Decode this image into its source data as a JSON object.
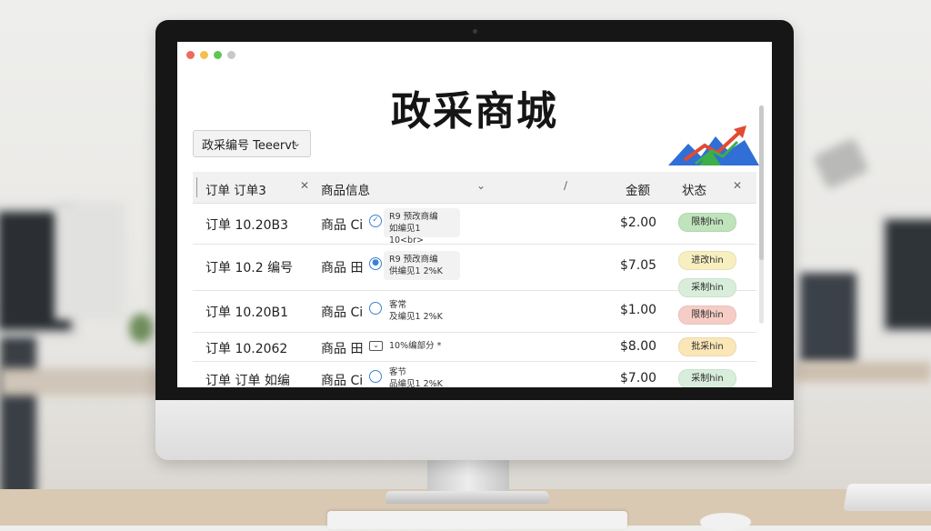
{
  "window": {
    "dot_colors": [
      "#ed6a5e",
      "#f5bf4f",
      "#61c554",
      "#c8c8c8"
    ]
  },
  "app": {
    "title": "政采商城"
  },
  "filter": {
    "label": "政采编号 Teeervt"
  },
  "table": {
    "columns": {
      "order": "订单 订单3",
      "product": "商品信息",
      "amount": "金额",
      "status": "状态"
    },
    "rows": [
      {
        "order": "订单 10.20B3",
        "product": "商品 Ci",
        "icon": "check-circle-icon",
        "detail_1": "R9 预改商编",
        "detail_2": "如编见1 10<br>",
        "amount": "$2.00",
        "status": [
          {
            "text": "限制hin",
            "color": "green"
          }
        ]
      },
      {
        "order": "订单 10.2 编号",
        "product": "商品 田",
        "icon": "radio-dot-icon",
        "detail_1": "R9 预改商编",
        "detail_2": "供编见1 2%K",
        "amount": "$7.05",
        "status": [
          {
            "text": "进改hin",
            "color": "yellow"
          },
          {
            "text": "采制hin",
            "color": "green-light"
          }
        ]
      },
      {
        "order": "订单 10.20B1",
        "product": "商品 Ci",
        "icon": "circle-icon",
        "detail_1": "客常",
        "detail_2": "及编见1 2%K",
        "amount": "$1.00",
        "status": [
          {
            "text": "限制hin",
            "color": "red"
          }
        ]
      },
      {
        "order": "订单 10.2062",
        "product": "商品 田",
        "icon": "mail-icon",
        "detail_1": "10%编部分 *",
        "detail_2": "",
        "amount": "$8.00",
        "status": [
          {
            "text": "批采hin",
            "color": "orange"
          }
        ]
      },
      {
        "order": "订单 订单 如编",
        "product": "商品 Ci",
        "icon": "circle-icon",
        "detail_1": "客节",
        "detail_2": "品编见1 2%K",
        "amount": "$7.00",
        "status": [
          {
            "text": "采制hin",
            "color": "green-light"
          }
        ]
      }
    ]
  }
}
